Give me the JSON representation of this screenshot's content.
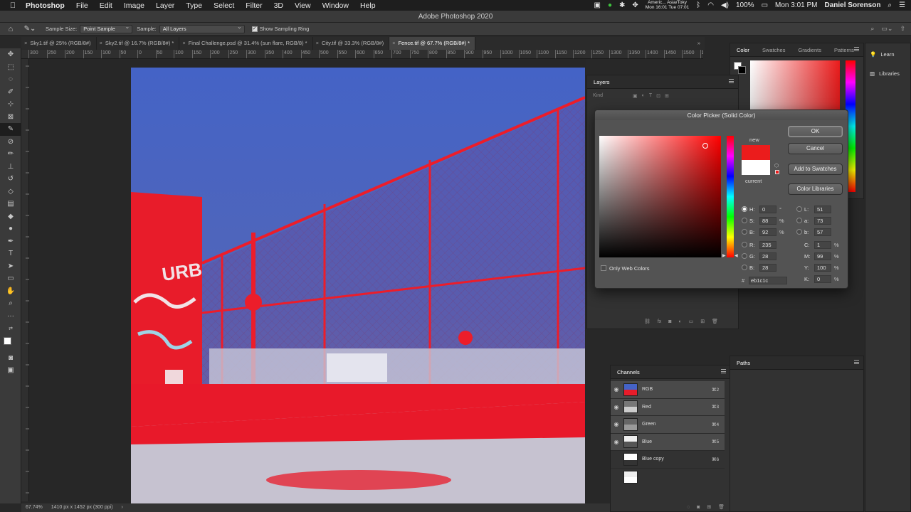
{
  "menubar": {
    "app": "Photoshop",
    "items": [
      "File",
      "Edit",
      "Image",
      "Layer",
      "Type",
      "Select",
      "Filter",
      "3D",
      "View",
      "Window",
      "Help"
    ],
    "clock_region_line1": "Americ...  Asia/Toky",
    "clock_region_line2": "Mon 16:01  Tue 07:01",
    "battery": "100%",
    "time": "Mon 3:01 PM",
    "user": "Daniel Sorenson"
  },
  "window": {
    "title": "Adobe Photoshop 2020"
  },
  "options": {
    "sample_size_label": "Sample Size:",
    "sample_size_value": "Point Sample",
    "sample_label": "Sample:",
    "sample_value": "All Layers",
    "show_ring_label": "Show Sampling Ring"
  },
  "tabs": [
    {
      "label": "Sky1.tif @ 25% (RGB/8#)",
      "active": false
    },
    {
      "label": "Sky2.tif @ 16.7% (RGB/8#) *",
      "active": false
    },
    {
      "label": "Final Challenge.psd @ 31.4% (sun flare, RGB/8) *",
      "active": false
    },
    {
      "label": "City.tif @ 33.3% (RGB/8#)",
      "active": false
    },
    {
      "label": "Fence.tif @ 67.7% (RGB/8#) *",
      "active": true
    }
  ],
  "ruler_ticks": [
    "300",
    "250",
    "200",
    "150",
    "100",
    "50",
    "0",
    "50",
    "100",
    "150",
    "200",
    "250",
    "300",
    "350",
    "400",
    "450",
    "500",
    "550",
    "600",
    "650",
    "700",
    "750",
    "800",
    "850",
    "900",
    "950",
    "1000",
    "1050",
    "1100",
    "1150",
    "1200",
    "1250",
    "1300",
    "1350",
    "1400",
    "1450",
    "1500",
    "15"
  ],
  "statusbar": {
    "zoom": "67.74%",
    "doc": "1410 px x 1452 px (300 ppi)"
  },
  "color_panel": {
    "tabs": [
      "Color",
      "Swatches",
      "Gradients",
      "Patterns"
    ],
    "active_tab": "Color"
  },
  "learn_panel": {
    "learn": "Learn",
    "libraries": "Libraries"
  },
  "layers_panel": {
    "title": "Layers",
    "kind": "Kind"
  },
  "color_picker": {
    "title": "Color Picker (Solid Color)",
    "new_label": "new",
    "current_label": "current",
    "ok": "OK",
    "cancel": "Cancel",
    "add_to_swatches": "Add to Swatches",
    "color_libraries": "Color Libraries",
    "only_web_colors": "Only Web Colors",
    "new_color": "#eb1c1c",
    "current_color": "#ffffff",
    "hsb": {
      "h": "0",
      "s": "88",
      "b": "92",
      "h_unit": "°",
      "s_unit": "%",
      "b_unit": "%"
    },
    "rgb": {
      "r": "235",
      "g": "28",
      "b": "28"
    },
    "lab": {
      "l": "51",
      "a": "73",
      "b": "57"
    },
    "cmyk": {
      "c": "1",
      "m": "99",
      "y": "100",
      "k": "0",
      "unit": "%"
    },
    "hex_label": "#",
    "hex": "eb1c1c",
    "labels": {
      "H": "H:",
      "S": "S:",
      "B": "B:",
      "R": "R:",
      "G": "G:",
      "B2": "B:",
      "L": "L:",
      "a": "a:",
      "b": "b:",
      "C": "C:",
      "M": "M:",
      "Y": "Y:",
      "K": "K:"
    }
  },
  "channels_panel": {
    "title": "Channels",
    "rows": [
      {
        "name": "RGB",
        "shortcut": "⌘2",
        "visible": true,
        "selected": true
      },
      {
        "name": "Red",
        "shortcut": "⌘3",
        "visible": true,
        "selected": true
      },
      {
        "name": "Green",
        "shortcut": "⌘4",
        "visible": true,
        "selected": true
      },
      {
        "name": "Blue",
        "shortcut": "⌘5",
        "visible": true,
        "selected": true
      },
      {
        "name": "Blue copy",
        "shortcut": "⌘6",
        "visible": false,
        "selected": false
      },
      {
        "name": "",
        "shortcut": "",
        "visible": false,
        "selected": false
      }
    ]
  },
  "paths_panel": {
    "title": "Paths"
  },
  "colors": {
    "accent_red": "#eb1c1c",
    "sky_blue": "#4a64c0",
    "ui_dark": "#323232"
  }
}
